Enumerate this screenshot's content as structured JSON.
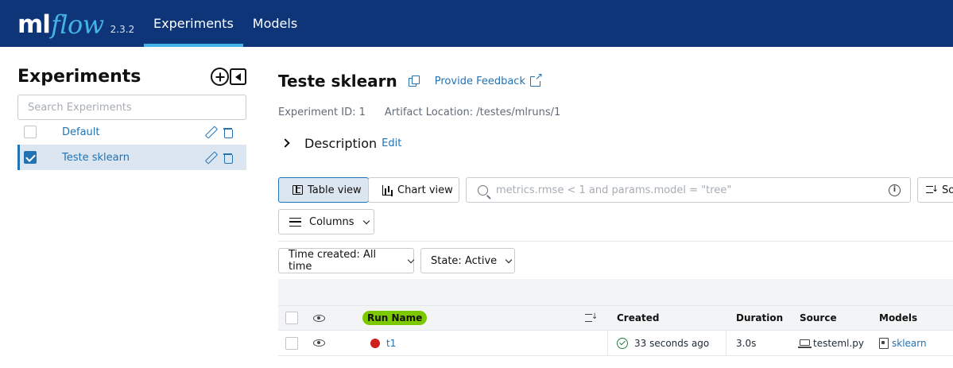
{
  "header": {
    "logo_ml": "ml",
    "logo_flow": "flow",
    "version": "2.3.2",
    "tabs": [
      {
        "label": "Experiments",
        "active": true
      },
      {
        "label": "Models",
        "active": false
      }
    ],
    "colors": {
      "bar": "#0e3578",
      "accent": "#43b3e8"
    }
  },
  "sidebar": {
    "title": "Experiments",
    "search_placeholder": "Search Experiments",
    "items": [
      {
        "name": "Default",
        "checked": false
      },
      {
        "name": "Teste sklearn",
        "checked": true
      }
    ]
  },
  "experiment": {
    "title": "Teste sklearn",
    "feedback_label": "Provide Feedback",
    "experiment_id": "Experiment ID: 1",
    "artifact_location": "Artifact Location: /testes/mlruns/1",
    "description_label": "Description",
    "edit_label": "Edit"
  },
  "toolbar": {
    "table_view_label": "Table view",
    "chart_view_label": "Chart view",
    "search_placeholder": "metrics.rmse < 1 and params.model = \"tree\"",
    "sort_label": "So",
    "columns_label": "Columns",
    "time_filter_label": "Time created: All time",
    "state_filter_label": "State: Active"
  },
  "runs_table": {
    "columns": [
      "Run Name",
      "Created",
      "Duration",
      "Source",
      "Models"
    ],
    "rows": [
      {
        "run_name": "t1",
        "status": "failed",
        "created": "33 seconds ago",
        "duration": "3.0s",
        "source": "testeml.py",
        "models": "sklearn"
      }
    ]
  }
}
